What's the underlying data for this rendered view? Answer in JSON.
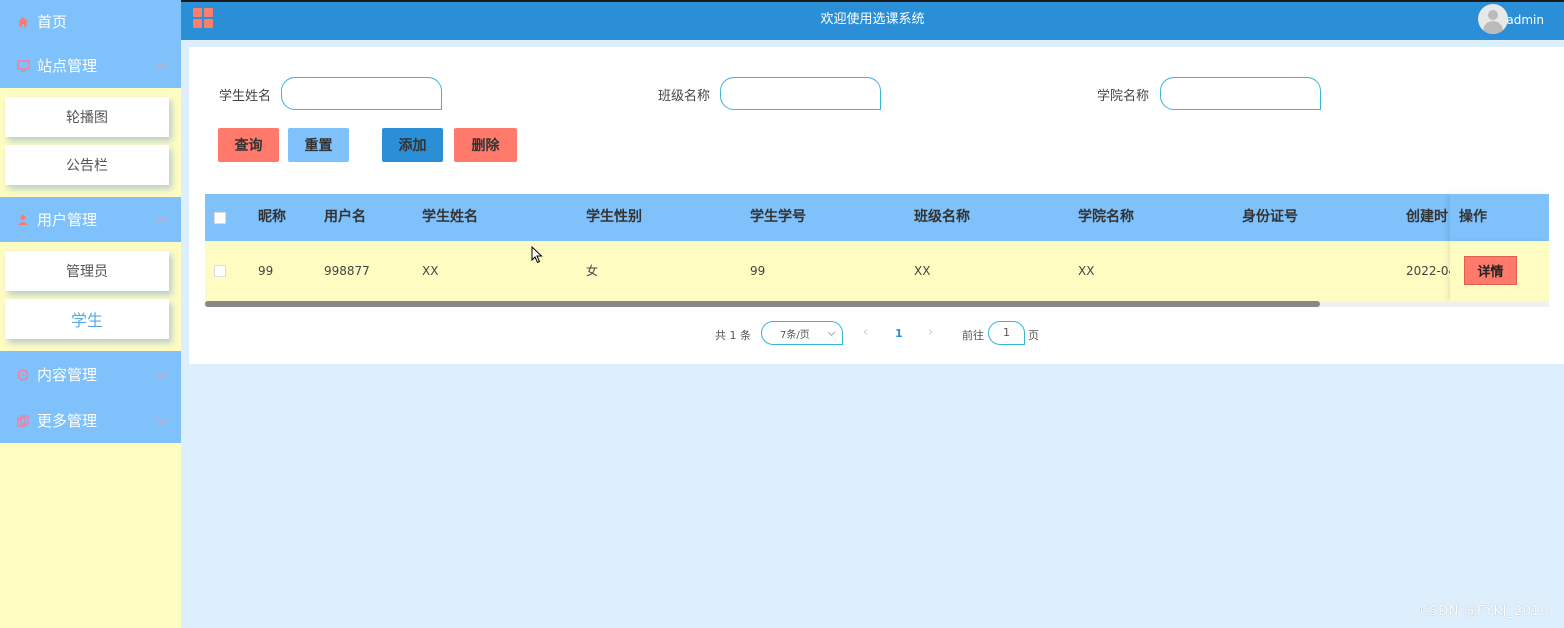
{
  "sidebar": {
    "home": {
      "label": "首页",
      "icon": "home-icon"
    },
    "groups": [
      {
        "label": "站点管理",
        "icon": "monitor-icon",
        "expanded": true,
        "items": [
          {
            "label": "轮播图"
          },
          {
            "label": "公告栏"
          }
        ]
      },
      {
        "label": "用户管理",
        "icon": "user-icon",
        "expanded": true,
        "items": [
          {
            "label": "管理员"
          },
          {
            "label": "学生",
            "active": true
          }
        ]
      },
      {
        "label": "内容管理",
        "icon": "chat-icon",
        "expanded": false,
        "items": []
      },
      {
        "label": "更多管理",
        "icon": "copy-icon",
        "expanded": false,
        "items": []
      }
    ]
  },
  "header": {
    "title": "欢迎使用选课系统",
    "username": "admin"
  },
  "search": {
    "fields": [
      {
        "label": "学生姓名",
        "value": ""
      },
      {
        "label": "班级名称",
        "value": ""
      },
      {
        "label": "学院名称",
        "value": ""
      }
    ]
  },
  "actions": {
    "query": "查询",
    "reset": "重置",
    "add": "添加",
    "delete": "删除"
  },
  "table": {
    "columns": [
      "昵称",
      "用户名",
      "学生姓名",
      "学生性别",
      "学生学号",
      "班级名称",
      "学院名称",
      "身份证号",
      "创建时间",
      "操作"
    ],
    "rows": [
      {
        "nickname": "99",
        "username": "998877",
        "name": "XX",
        "gender": "女",
        "student_no": "99",
        "class_name": "XX",
        "college": "XX",
        "id_no": "",
        "created": "2022-04-",
        "action": "详情"
      }
    ],
    "visible_header_clip": "创建时"
  },
  "pagination": {
    "total": "共 1 条",
    "page_size": "7条/页",
    "current_page": "1",
    "goto_prefix": "前往",
    "goto_value": "1",
    "goto_suffix": "页"
  },
  "watermark": "CSDN @FYKJ_2010",
  "colors": {
    "header": "#2b8fd8",
    "sidebar_head": "#7fc1fb",
    "sidebar_bg": "#fffcc2",
    "danger": "#ff7a6b",
    "main_bg": "#ddeffc"
  }
}
